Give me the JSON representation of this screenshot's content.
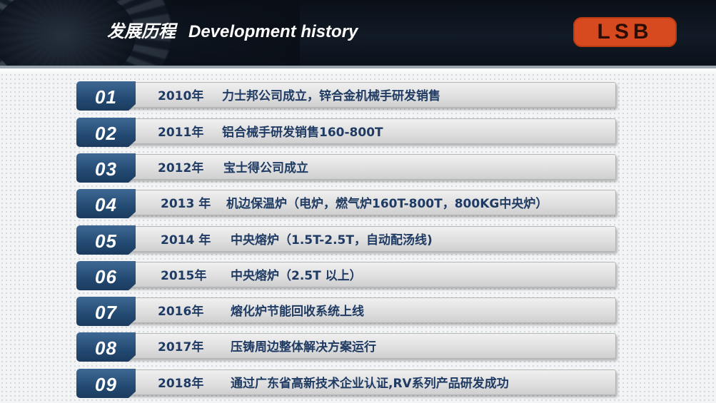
{
  "header": {
    "title_cn": "发展历程",
    "title_en": "Development history",
    "logo_text": "LSB",
    "logo_color": "#d74a1f"
  },
  "timeline": [
    {
      "num": "01",
      "year": "2010年",
      "desc": "力士邦公司成立，锌合金机械手研发销售"
    },
    {
      "num": "02",
      "year": "2011年",
      "desc": "铝合械手研发销售160-800T"
    },
    {
      "num": "03",
      "year": "2012年",
      "desc": "宝士得公司成立"
    },
    {
      "num": "04",
      "year": "2013 年",
      "desc": "机边保温炉（电炉，燃气炉160T-800T，800KG中央炉）"
    },
    {
      "num": "05",
      "year": "2014 年",
      "desc": "中央熔炉（1.5T-2.5T，自动配汤线)"
    },
    {
      "num": "06",
      "year": "2015年",
      "desc": "中央熔炉（2.5T 以上）"
    },
    {
      "num": "07",
      "year": "2016年",
      "desc": "熔化炉节能回收系统上线"
    },
    {
      "num": "08",
      "year": "2017年",
      "desc": "压铸周边整体解决方案运行"
    },
    {
      "num": "09",
      "year": "2018年",
      "desc": "通过广东省高新技术企业认证,RV系列产品研发成功"
    }
  ],
  "colors": {
    "number_badge": "#234a72",
    "text": "#1f3b63",
    "bar": "#dedede",
    "header_bg": "#0b111a"
  }
}
